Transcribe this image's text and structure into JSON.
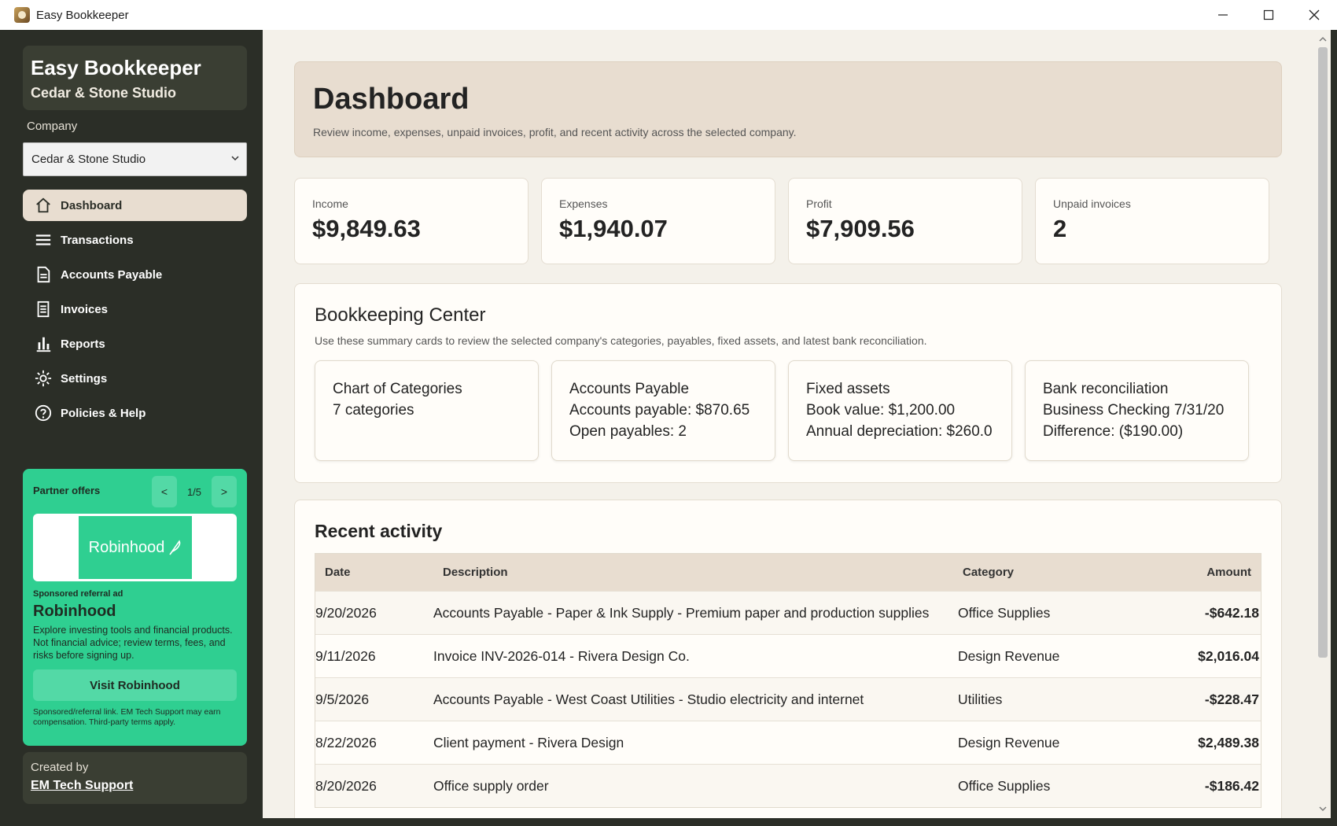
{
  "window": {
    "title": "Easy Bookkeeper"
  },
  "sidebar": {
    "brand_title": "Easy Bookkeeper",
    "brand_subtitle": "Cedar & Stone Studio",
    "company_label": "Company",
    "company_selected": "Cedar & Stone Studio",
    "nav": [
      {
        "label": "Dashboard",
        "icon": "home-icon",
        "active": true
      },
      {
        "label": "Transactions",
        "icon": "list-icon"
      },
      {
        "label": "Accounts Payable",
        "icon": "document-icon"
      },
      {
        "label": "Invoices",
        "icon": "invoice-icon"
      },
      {
        "label": "Reports",
        "icon": "bar-chart-icon"
      },
      {
        "label": "Settings",
        "icon": "gear-icon"
      },
      {
        "label": "Policies & Help",
        "icon": "help-icon"
      }
    ],
    "partner": {
      "label": "Partner offers",
      "prev": "<",
      "next": ">",
      "page": "1/5",
      "logo_text": "Robinhood",
      "sponsored": "Sponsored referral ad",
      "name": "Robinhood",
      "description": "Explore investing tools and financial products. Not financial advice; review terms, fees, and risks before signing up.",
      "cta": "Visit Robinhood",
      "footer": "Sponsored/referral link. EM Tech Support may earn compensation. Third-party terms apply."
    },
    "created_by_label": "Created by",
    "created_by_link": "EM Tech Support"
  },
  "dashboard": {
    "title": "Dashboard",
    "subtitle": "Review income, expenses, unpaid invoices, profit, and recent activity across the selected company.",
    "stats": [
      {
        "label": "Income",
        "value": "$9,849.63"
      },
      {
        "label": "Expenses",
        "value": "$1,940.07"
      },
      {
        "label": "Profit",
        "value": "$7,909.56"
      },
      {
        "label": "Unpaid invoices",
        "value": "2"
      }
    ]
  },
  "bookkeeping": {
    "title": "Bookkeeping Center",
    "subtitle": "Use these summary cards to review the selected company's categories, payables, fixed assets, and latest bank reconciliation.",
    "cards": [
      {
        "lines": [
          "Chart of Categories",
          "7 categories"
        ]
      },
      {
        "lines": [
          "Accounts Payable",
          "Accounts payable: $870.65",
          "Open payables: 2"
        ]
      },
      {
        "lines": [
          "Fixed assets",
          "Book value: $1,200.00",
          "Annual depreciation: $260.0"
        ]
      },
      {
        "lines": [
          "Bank reconciliation",
          "Business Checking 7/31/20",
          "Difference: ($190.00)"
        ]
      }
    ]
  },
  "recent": {
    "title": "Recent activity",
    "columns": [
      "Date",
      "Description",
      "Category",
      "Amount"
    ],
    "rows": [
      {
        "date": "9/20/2026",
        "description": "Accounts Payable - Paper & Ink Supply - Premium paper and production supplies",
        "category": "Office Supplies",
        "amount": "-$642.18"
      },
      {
        "date": "9/11/2026",
        "description": "Invoice INV-2026-014 - Rivera Design Co.",
        "category": "Design Revenue",
        "amount": "$2,016.04"
      },
      {
        "date": "9/5/2026",
        "description": "Accounts Payable - West Coast Utilities - Studio electricity and internet",
        "category": "Utilities",
        "amount": "-$228.47"
      },
      {
        "date": "8/22/2026",
        "description": "Client payment - Rivera Design",
        "category": "Design Revenue",
        "amount": "$2,489.38"
      },
      {
        "date": "8/20/2026",
        "description": "Office supply order",
        "category": "Office Supplies",
        "amount": "-$186.42"
      }
    ]
  }
}
